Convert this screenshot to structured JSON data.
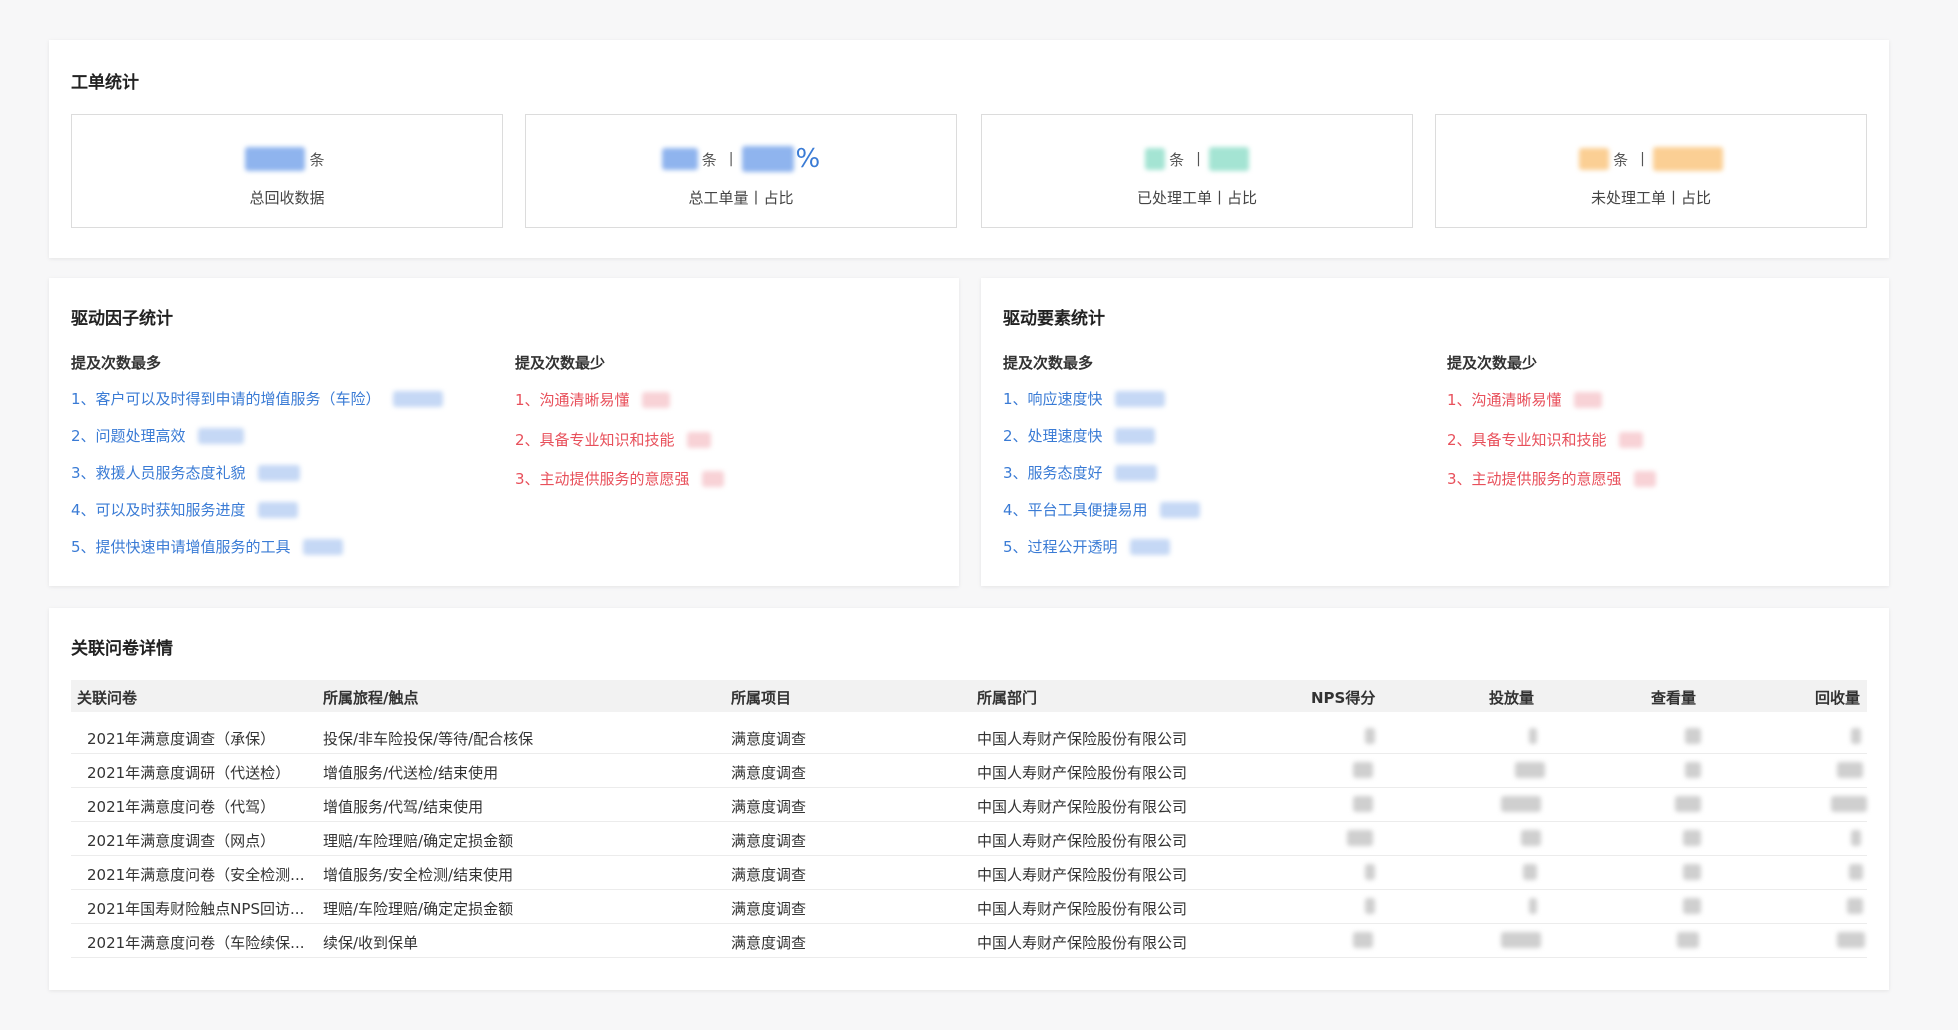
{
  "stats": {
    "title": "工单统计",
    "cards": [
      {
        "label": "总回收数据",
        "unit": "条",
        "separator": "",
        "percent_sign": ""
      },
      {
        "label": "总工单量丨占比",
        "unit": "条",
        "separator": "|",
        "percent_sign": "%"
      },
      {
        "label": "已处理工单丨占比",
        "unit": "条",
        "separator": "|",
        "percent_sign": ""
      },
      {
        "label": "未处理工单丨占比",
        "unit": "条",
        "separator": "|",
        "percent_sign": ""
      }
    ],
    "colors": {
      "blue": "#6f9ee8",
      "teal": "#8fd8c4",
      "orange": "#f9c27a"
    }
  },
  "factors": {
    "title": "驱动因子统计",
    "most_label": "提及次数最多",
    "least_label": "提及次数最少",
    "most": [
      "1、客户可以及时得到申请的增值服务（车险）",
      "2、问题处理高效",
      "3、救援人员服务态度礼貌",
      "4、可以及时获知服务进度",
      "5、提供快速申请增值服务的工具"
    ],
    "least": [
      "1、沟通清晰易懂",
      "2、具备专业知识和技能",
      "3、主动提供服务的意愿强"
    ]
  },
  "elements": {
    "title": "驱动要素统计",
    "most_label": "提及次数最多",
    "least_label": "提及次数最少",
    "most": [
      "1、响应速度快",
      "2、处理速度快",
      "3、服务态度好",
      "4、平台工具便捷易用",
      "5、过程公开透明"
    ],
    "least": [
      "1、沟通清晰易懂",
      "2、具备专业知识和技能",
      "3、主动提供服务的意愿强"
    ]
  },
  "survey_table": {
    "title": "关联问卷详情",
    "columns": [
      "关联问卷",
      "所属旅程/触点",
      "所属项目",
      "所属部门",
      "NPS得分",
      "投放量",
      "查看量",
      "回收量"
    ],
    "rows": [
      {
        "name": "2021年满意度调查（承保）",
        "journey": "投保/非车险投保/等待/配合核保",
        "project": "满意度调查",
        "dept": "中国人寿财产保险股份有限公司"
      },
      {
        "name": "2021年满意度调研（代送检）",
        "journey": "增值服务/代送检/结束使用",
        "project": "满意度调查",
        "dept": "中国人寿财产保险股份有限公司"
      },
      {
        "name": "2021年满意度问卷（代驾）",
        "journey": "增值服务/代驾/结束使用",
        "project": "满意度调查",
        "dept": "中国人寿财产保险股份有限公司"
      },
      {
        "name": "2021年满意度调查（网点）",
        "journey": "理赔/车险理赔/确定定损金额",
        "project": "满意度调查",
        "dept": "中国人寿财产保险股份有限公司"
      },
      {
        "name": "2021年满意度问卷（安全检测...",
        "journey": "增值服务/安全检测/结束使用",
        "project": "满意度调查",
        "dept": "中国人寿财产保险股份有限公司"
      },
      {
        "name": "2021年国寿财险触点NPS回访...",
        "journey": "理赔/车险理赔/确定定损金额",
        "project": "满意度调查",
        "dept": "中国人寿财产保险股份有限公司"
      },
      {
        "name": "2021年满意度问卷（车险续保...",
        "journey": "续保/收到保单",
        "project": "满意度调查",
        "dept": "中国人寿财产保险股份有限公司"
      }
    ]
  }
}
